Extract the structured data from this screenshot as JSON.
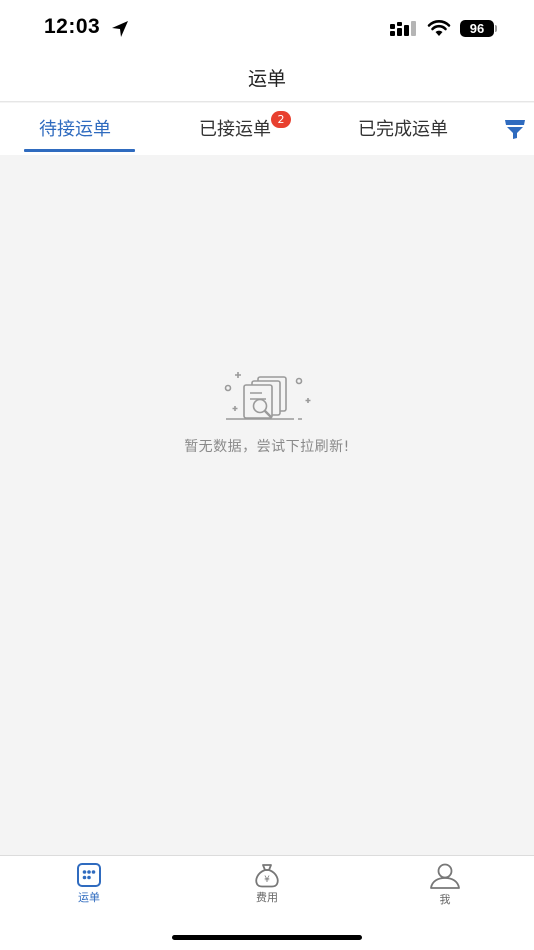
{
  "status_bar": {
    "time": "12:03",
    "battery": "96"
  },
  "header": {
    "title": "运单"
  },
  "tabs": [
    {
      "label": "待接运单",
      "active": true
    },
    {
      "label": "已接运单",
      "badge": "2"
    },
    {
      "label": "已完成运单"
    }
  ],
  "empty_state": {
    "message": "暂无数据，尝试下拉刷新!"
  },
  "bottom_nav": [
    {
      "label": "运单",
      "icon": "waybill-icon",
      "active": true
    },
    {
      "label": "费用",
      "icon": "money-bag-icon"
    },
    {
      "label": "我",
      "icon": "user-icon"
    }
  ],
  "colors": {
    "accent": "#2f6bbf",
    "badge": "#e8402f",
    "background": "#f4f4f4"
  }
}
